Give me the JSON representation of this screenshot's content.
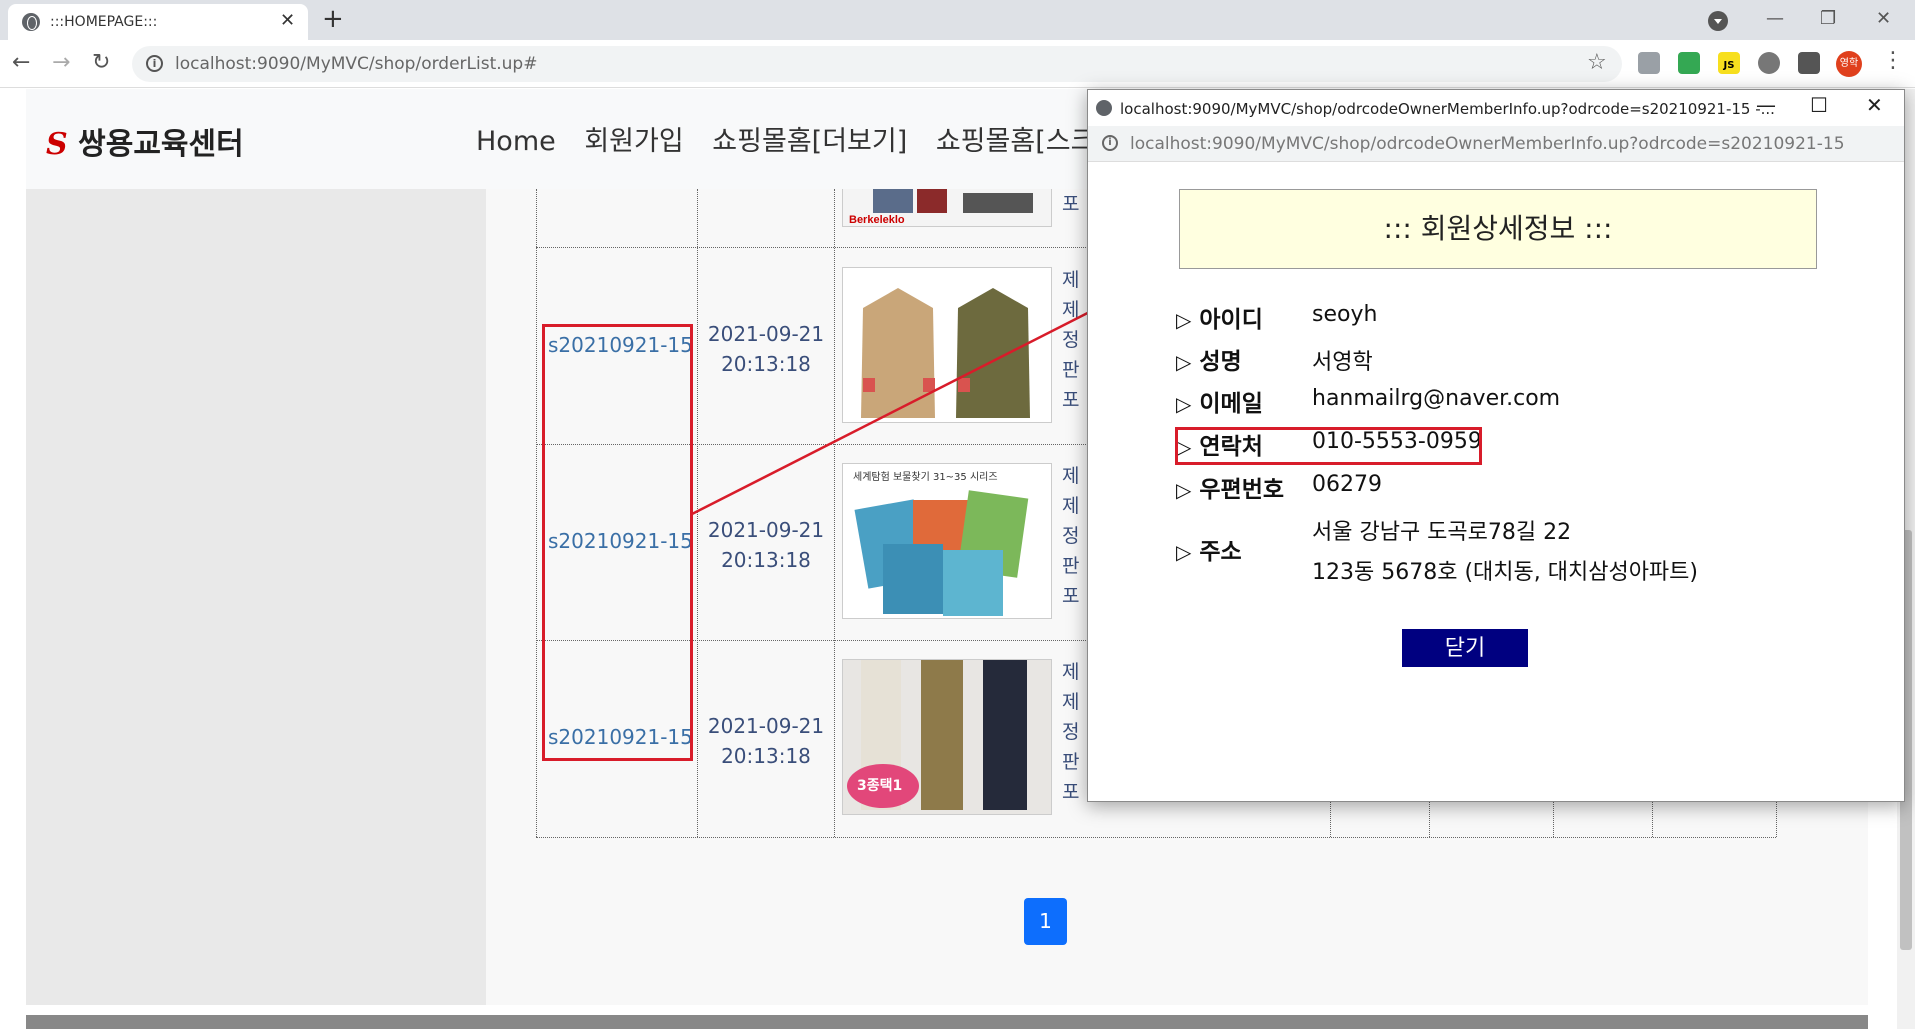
{
  "browser": {
    "tab_title": ":::HOMEPAGE:::",
    "tab_close": "✕",
    "new_tab": "+",
    "url": "localhost:9090/MyMVC/shop/orderList.up#",
    "avatar_text": "영학",
    "ext_js": "JS"
  },
  "site": {
    "logo_mark": "S",
    "logo_text": "쌍용교육센터",
    "nav": [
      "Home",
      "회원가입",
      "쇼핑몰홈[더보기]",
      "쇼핑몰홈[스크롤"
    ]
  },
  "orders": [
    {
      "odrcode": "s20210921-15",
      "date": "2021-09-21",
      "time": "20:13:18",
      "peek": [
        "제",
        "제",
        "정",
        "판",
        "포"
      ]
    },
    {
      "odrcode": "s20210921-15",
      "date": "2021-09-21",
      "time": "20:13:18",
      "peek": [
        "제",
        "제",
        "정",
        "판",
        "포"
      ]
    },
    {
      "odrcode": "s20210921-15",
      "date": "2021-09-21",
      "time": "20:13:18",
      "peek": [
        "제",
        "제",
        "정",
        "판",
        "포"
      ]
    }
  ],
  "top_row_peek": "포",
  "thumb_labels": {
    "brand": "Berkeleklo",
    "book": "세계탐험 보물찾기 31~35 시리즈",
    "pants": "3종택1"
  },
  "pagination": {
    "current": "1"
  },
  "popup": {
    "window_title": "localhost:9090/MyMVC/shop/odrcodeOwnerMemberInfo.up?odrcode=s20210921-15 -...",
    "url": "localhost:9090/MyMVC/shop/odrcodeOwnerMemberInfo.up?odrcode=s20210921-15",
    "heading": "::: 회원상세정보 :::",
    "fields": [
      {
        "label": "아이디",
        "value": "seoyh"
      },
      {
        "label": "성명",
        "value": "서영학"
      },
      {
        "label": "이메일",
        "value": "hanmailrg@naver.com"
      },
      {
        "label": "연락처",
        "value": "010-5553-0959"
      },
      {
        "label": "우편번호",
        "value": "06279"
      },
      {
        "label": "주소",
        "value": "서울 강남구 도곡로78길 22",
        "value2": "123동 5678호 (대치동, 대치삼성아파트)"
      }
    ],
    "close_label": "닫기"
  },
  "colors": {
    "accent": "#0d6efd",
    "highlight": "#d81c2a",
    "close_button": "#000080",
    "heading_bg": "#ffffe0"
  }
}
